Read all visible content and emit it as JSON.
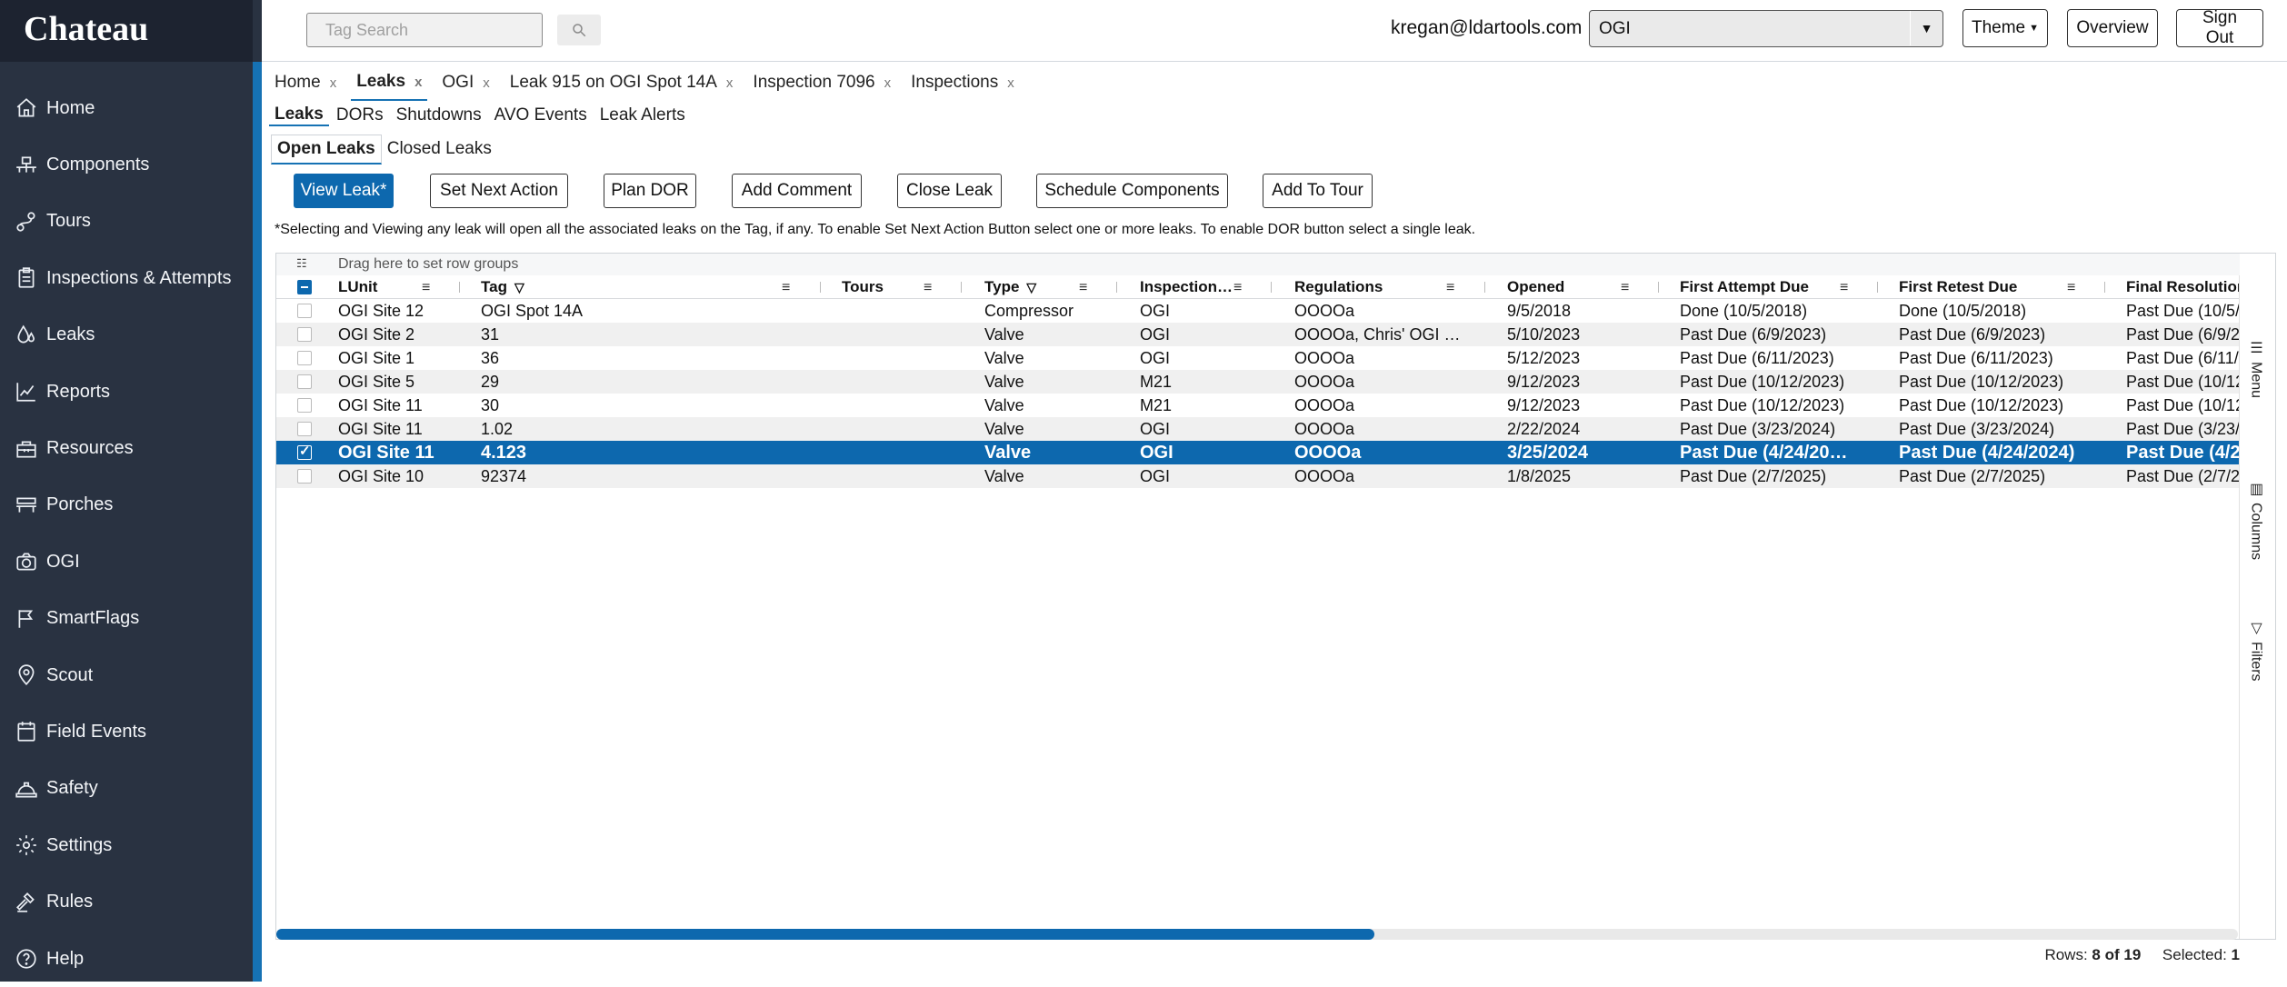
{
  "app": {
    "brand": "Chateau"
  },
  "sidebar": {
    "items": [
      {
        "label": "Home",
        "icon": "home-icon"
      },
      {
        "label": "Components",
        "icon": "components-icon"
      },
      {
        "label": "Tours",
        "icon": "tours-icon"
      },
      {
        "label": "Inspections & Attempts",
        "icon": "clipboard-icon"
      },
      {
        "label": "Leaks",
        "icon": "drop-icon"
      },
      {
        "label": "Reports",
        "icon": "chart-icon"
      },
      {
        "label": "Resources",
        "icon": "toolbox-icon"
      },
      {
        "label": "Porches",
        "icon": "bench-icon"
      },
      {
        "label": "OGI",
        "icon": "camera-icon"
      },
      {
        "label": "SmartFlags",
        "icon": "flag-icon"
      },
      {
        "label": "Scout",
        "icon": "map-pin-icon"
      },
      {
        "label": "Field Events",
        "icon": "event-icon"
      },
      {
        "label": "Safety",
        "icon": "hardhat-icon"
      },
      {
        "label": "Settings",
        "icon": "gear-icon"
      },
      {
        "label": "Rules",
        "icon": "gavel-icon"
      },
      {
        "label": "Help",
        "icon": "help-icon"
      }
    ]
  },
  "topbar": {
    "search_placeholder": "Tag Search",
    "user_email": "kregan@ldartools.com",
    "org_value": "OGI",
    "theme_label": "Theme",
    "overview_label": "Overview",
    "signout_label": "Sign Out"
  },
  "page_tabs": [
    {
      "label": "Home",
      "active": false
    },
    {
      "label": "Leaks",
      "active": true
    },
    {
      "label": "OGI",
      "active": false
    },
    {
      "label": "Leak 915 on OGI Spot 14A",
      "active": false
    },
    {
      "label": "Inspection 7096",
      "active": false
    },
    {
      "label": "Inspections",
      "active": false
    }
  ],
  "sub_tabs": [
    "Leaks",
    "DORs",
    "Shutdowns",
    "AVO Events",
    "Leak Alerts"
  ],
  "leak_tabs": [
    "Open Leaks",
    "Closed Leaks"
  ],
  "actions": {
    "view_leak": "View Leak*",
    "set_next_action": "Set Next Action",
    "plan_dor": "Plan DOR",
    "add_comment": "Add Comment",
    "close_leak": "Close Leak",
    "schedule_components": "Schedule Components",
    "add_to_tour": "Add To Tour"
  },
  "note": "*Selecting and Viewing any leak will open all the associated leaks on the Tag, if any. To enable Set Next Action Button select one or more leaks. To enable DOR button select a single leak.",
  "grid": {
    "group_hint": "Drag here to set row groups",
    "columns": [
      "LUnit",
      "Tag",
      "Tours",
      "Type",
      "Inspection…",
      "Regulations",
      "Opened",
      "First Attempt Due",
      "First Retest Due",
      "Final Resolution"
    ],
    "rows": [
      [
        "OGI Site 12",
        "OGI Spot 14A",
        "",
        "Compressor",
        "OGI",
        "OOOOa",
        "9/5/2018",
        "Done (10/5/2018)",
        "Done (10/5/2018)",
        "Past Due (10/5/"
      ],
      [
        "OGI Site 2",
        "31",
        "",
        "Valve",
        "OGI",
        "OOOOa, Chris' OGI …",
        "5/10/2023",
        "Past Due (6/9/2023)",
        "Past Due (6/9/2023)",
        "Past Due (6/9/2"
      ],
      [
        "OGI Site 1",
        "36",
        "",
        "Valve",
        "OGI",
        "OOOOa",
        "5/12/2023",
        "Past Due (6/11/2023)",
        "Past Due (6/11/2023)",
        "Past Due (6/11/"
      ],
      [
        "OGI Site 5",
        "29",
        "",
        "Valve",
        "M21",
        "OOOOa",
        "9/12/2023",
        "Past Due (10/12/2023)",
        "Past Due (10/12/2023)",
        "Past Due (10/12"
      ],
      [
        "OGI Site 11",
        "30",
        "",
        "Valve",
        "M21",
        "OOOOa",
        "9/12/2023",
        "Past Due (10/12/2023)",
        "Past Due (10/12/2023)",
        "Past Due (10/12"
      ],
      [
        "OGI Site 11",
        "1.02",
        "",
        "Valve",
        "OGI",
        "OOOOa",
        "2/22/2024",
        "Past Due (3/23/2024)",
        "Past Due (3/23/2024)",
        "Past Due (3/23/"
      ],
      [
        "OGI Site 11",
        "4.123",
        "",
        "Valve",
        "OGI",
        "OOOOa",
        "3/25/2024",
        "Past Due (4/24/20…",
        "Past Due (4/24/2024)",
        "Past Due (4/2"
      ],
      [
        "OGI Site 10",
        "92374",
        "",
        "Valve",
        "OGI",
        "OOOOa",
        "1/8/2025",
        "Past Due (2/7/2025)",
        "Past Due (2/7/2025)",
        "Past Due (2/7/2"
      ]
    ],
    "selected_row_index": 6,
    "side_tabs": [
      "Menu",
      "Columns",
      "Filters"
    ],
    "footer": {
      "rows_label": "Rows:",
      "rows_value": "8 of 19",
      "selected_label": "Selected:",
      "selected_value": "1"
    },
    "scroll_fraction": 0.56
  }
}
